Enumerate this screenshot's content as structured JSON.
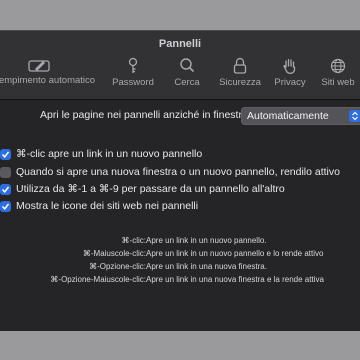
{
  "window": {
    "title": "Pannelli"
  },
  "toolbar": {
    "tabs": [
      {
        "label": "Riempimento automatico",
        "icon": "autofill-icon"
      },
      {
        "label": "Password",
        "icon": "key-icon"
      },
      {
        "label": "Cerca",
        "icon": "search-icon"
      },
      {
        "label": "Sicurezza",
        "icon": "lock-icon"
      },
      {
        "label": "Privacy",
        "icon": "hand-icon"
      },
      {
        "label": "Siti web",
        "icon": "globe-icon"
      }
    ]
  },
  "open_pages": {
    "label": "Apri le pagine nei pannelli anziché in finestre:",
    "value": "Automaticamente"
  },
  "options": [
    {
      "label": "⌘-clic apre un link in un nuovo pannello",
      "checked": true
    },
    {
      "label": "Quando si apre una nuova finestra o un nuovo pannello, rendilo attivo",
      "checked": false
    },
    {
      "label": "Utilizza da ⌘-1 a ⌘-9 per passare da un pannello all'altro",
      "checked": true
    },
    {
      "label": "Mostra le icone dei siti web nei pannelli",
      "checked": true
    }
  ],
  "shortcuts": [
    {
      "key": "⌘-clic:",
      "desc": "Apre un link in un nuovo pannello."
    },
    {
      "key": "⌘-Maiuscole-clic:",
      "desc": "Apre un link in un nuovo pannello e lo rende attivo"
    },
    {
      "key": "⌘-Opzione-clic:",
      "desc": "Apre un link in una nuova finestra."
    },
    {
      "key": "⌘-Opzione-Maiuscole-clic:",
      "desc": "Apre un link in una nuova finestra e la rende attiva"
    }
  ],
  "colors": {
    "accent": "#2d6fe0",
    "background": "#252527",
    "toolbar": "#323235"
  }
}
